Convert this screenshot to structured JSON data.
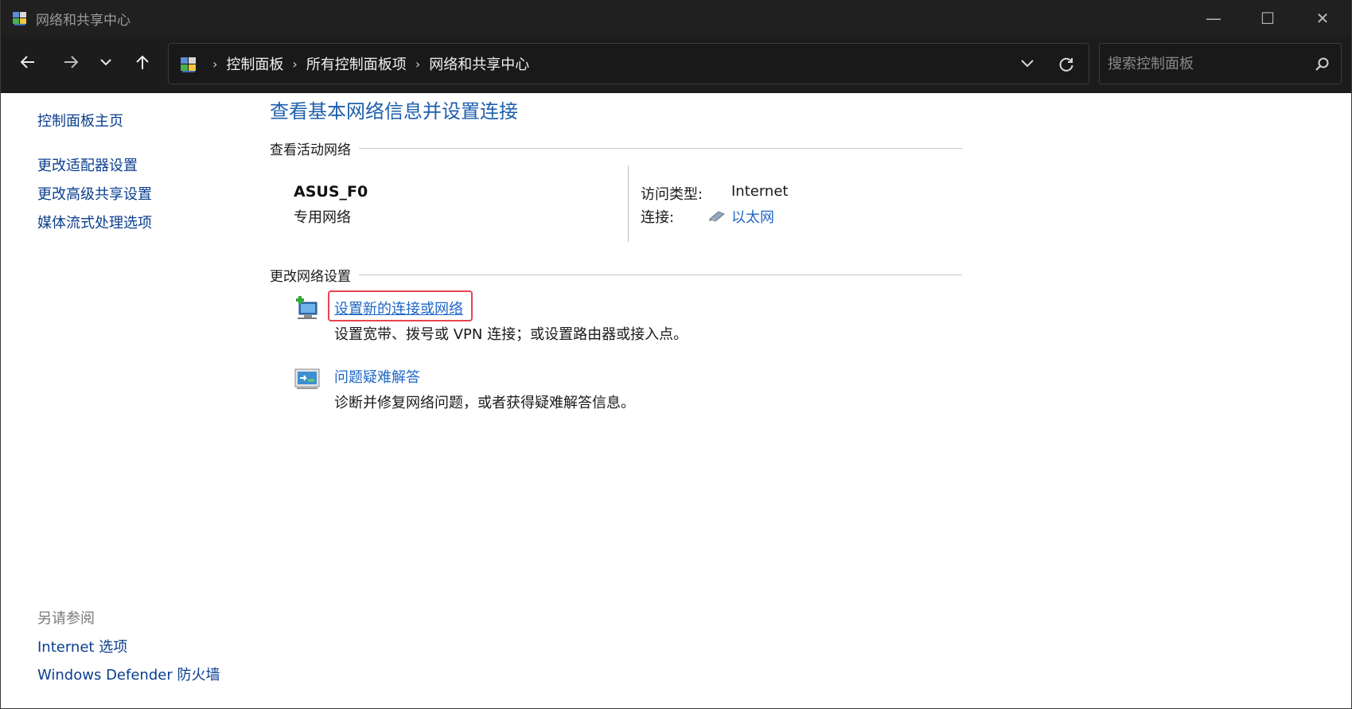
{
  "window": {
    "title": "网络和共享中心",
    "controls": {
      "minimize": "—",
      "maximize": "☐",
      "close": "✕"
    }
  },
  "nav": {
    "breadcrumbs": [
      "控制面板",
      "所有控制面板项",
      "网络和共享中心"
    ],
    "search_placeholder": "搜索控制面板",
    "icons": [
      "back-arrow-icon",
      "forward-arrow-icon",
      "chevron-down-icon",
      "up-arrow-icon",
      "refresh-icon",
      "search-icon"
    ]
  },
  "sidebar": {
    "home": "控制面板主页",
    "links": [
      "更改适配器设置",
      "更改高级共享设置",
      "媒体流式处理选项"
    ],
    "see_also_title": "另请参阅",
    "see_also": [
      "Internet 选项",
      "Windows Defender 防火墙"
    ]
  },
  "main": {
    "title": "查看基本网络信息并设置连接",
    "active_section": "查看活动网络",
    "network": {
      "name": "ASUS_F0",
      "type": "专用网络",
      "access_label": "访问类型:",
      "access_value": "Internet",
      "connection_label": "连接:",
      "connection_value": "以太网"
    },
    "change_section": "更改网络设置",
    "tasks": [
      {
        "link": "设置新的连接或网络",
        "desc": "设置宽带、拨号或 VPN 连接；或设置路由器或接入点。",
        "icon": "new-connection-icon"
      },
      {
        "link": "问题疑难解答",
        "desc": "诊断并修复网络问题，或者获得疑难解答信息。",
        "icon": "troubleshoot-icon"
      }
    ]
  },
  "colors": {
    "titlebar": "#202020",
    "navbar": "#1c1c1c",
    "link": "#1f67c7",
    "title_blue": "#1e5fad",
    "highlight_box": "#e64553"
  }
}
